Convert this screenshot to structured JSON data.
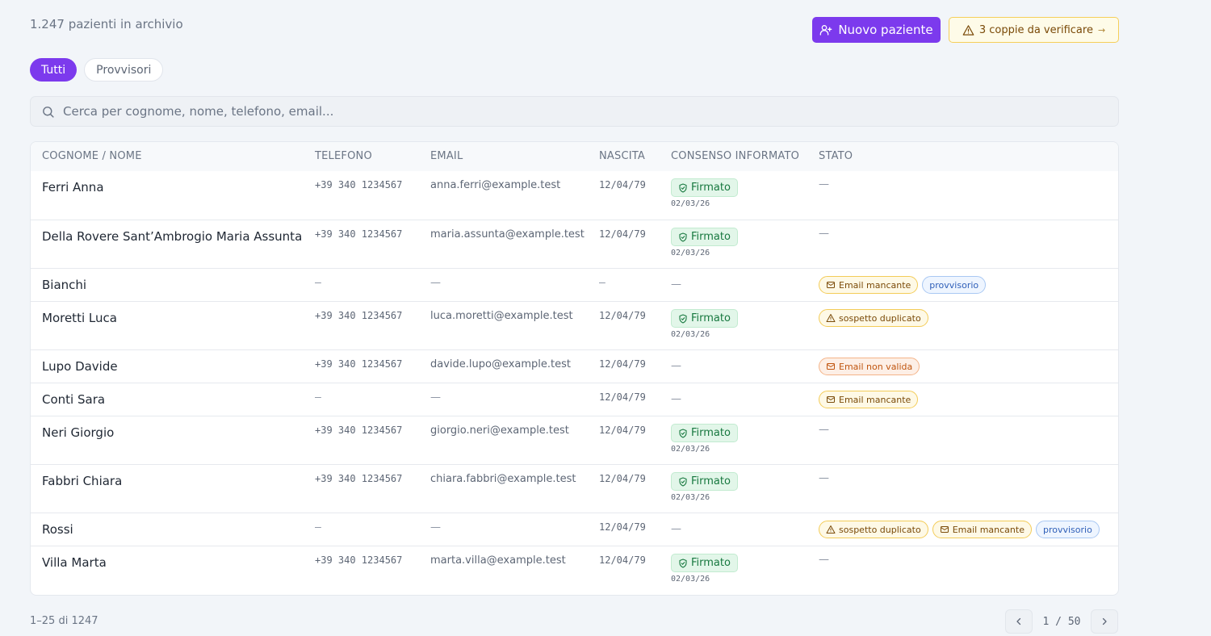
{
  "header": {
    "count_text": "1.247 pazienti in archivio",
    "new_patient_label": "Nuovo paziente",
    "verify_label": "3 coppie da verificare",
    "verify_arrow": "→"
  },
  "filters": [
    {
      "label": "Tutti",
      "active": true
    },
    {
      "label": "Provvisori",
      "active": false
    }
  ],
  "search": {
    "placeholder": "Cerca per cognome, nome, telefono, email..."
  },
  "table": {
    "columns": {
      "name": "COGNOME / NOME",
      "phone": "TELEFONO",
      "email": "EMAIL",
      "birth": "NASCITA",
      "consent": "CONSENSO INFORMATO",
      "status": "STATO"
    },
    "dash": "—",
    "signed_label": "Firmato",
    "rows": [
      {
        "name": "Ferri Anna",
        "phone": "+39 340 1234567",
        "email": "anna.ferri@example.test",
        "birth": "12/04/79",
        "consent": "02/03/26",
        "tags": []
      },
      {
        "name": "Della Rovere Sant’Ambrogio Maria Assunta",
        "phone": "+39 340 1234567",
        "email": "maria.assunta@example.test",
        "birth": "12/04/79",
        "consent": "02/03/26",
        "tags": []
      },
      {
        "name": "Bianchi",
        "phone": "",
        "email": "",
        "birth": "",
        "consent": "",
        "tags": [
          {
            "kind": "warn",
            "icon": "mail-icon",
            "label": "Email mancante"
          },
          {
            "kind": "info",
            "icon": "",
            "label": "provvisorio"
          }
        ]
      },
      {
        "name": "Moretti Luca",
        "phone": "+39 340 1234567",
        "email": "luca.moretti@example.test",
        "birth": "12/04/79",
        "consent": "02/03/26",
        "tags": [
          {
            "kind": "warn",
            "icon": "alert-triangle-icon",
            "label": "sospetto duplicato"
          }
        ]
      },
      {
        "name": "Lupo Davide",
        "phone": "+39 340 1234567",
        "email": "davide.lupo@example.test",
        "birth": "12/04/79",
        "consent": "",
        "tags": [
          {
            "kind": "err",
            "icon": "mail-icon",
            "label": "Email non valida"
          }
        ]
      },
      {
        "name": "Conti Sara",
        "phone": "",
        "email": "",
        "birth": "12/04/79",
        "consent": "",
        "tags": [
          {
            "kind": "warn",
            "icon": "mail-icon",
            "label": "Email mancante"
          }
        ]
      },
      {
        "name": "Neri Giorgio",
        "phone": "+39 340 1234567",
        "email": "giorgio.neri@example.test",
        "birth": "12/04/79",
        "consent": "02/03/26",
        "tags": []
      },
      {
        "name": "Fabbri Chiara",
        "phone": "+39 340 1234567",
        "email": "chiara.fabbri@example.test",
        "birth": "12/04/79",
        "consent": "02/03/26",
        "tags": []
      },
      {
        "name": "Rossi",
        "phone": "",
        "email": "",
        "birth": "12/04/79",
        "consent": "",
        "tags": [
          {
            "kind": "warn",
            "icon": "alert-triangle-icon",
            "label": "sospetto duplicato"
          },
          {
            "kind": "warn",
            "icon": "mail-icon",
            "label": "Email mancante"
          },
          {
            "kind": "info",
            "icon": "",
            "label": "provvisorio"
          }
        ]
      },
      {
        "name": "Villa Marta",
        "phone": "+39 340 1234567",
        "email": "marta.villa@example.test",
        "birth": "12/04/79",
        "consent": "02/03/26",
        "tags": []
      }
    ]
  },
  "footer": {
    "range_text": "1–25 di 1247",
    "page_text": "1 / 50"
  },
  "colors": {
    "accent": "#7c3aed",
    "success": "#17783f",
    "warning": "#7a4a08",
    "error": "#c0550f",
    "info": "#2f5fb8"
  }
}
